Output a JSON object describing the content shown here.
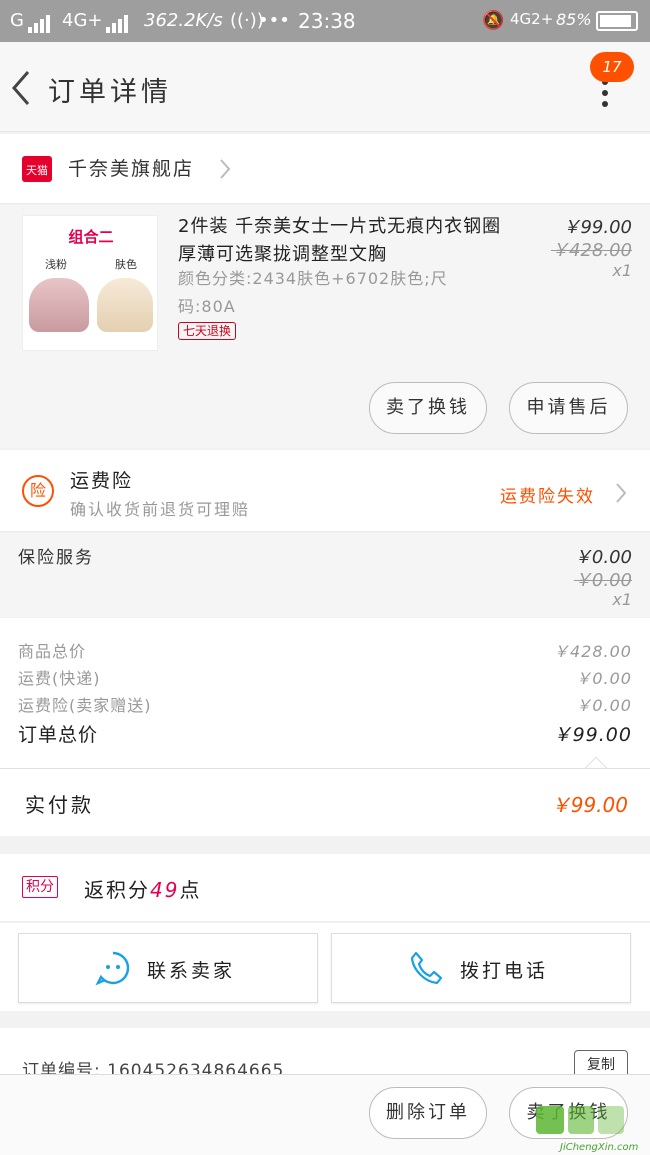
{
  "status_bar": {
    "carrier1": "G",
    "carrier2": "4G+",
    "speed": "362.2K/s",
    "dots": "•••",
    "time": "23:38",
    "net": "4G2+",
    "battery": "85%"
  },
  "header": {
    "title": "订单详情",
    "badge": "17"
  },
  "store": {
    "logo_text": "天猫",
    "name": "千奈美旗舰店"
  },
  "product": {
    "image_label": "组合二",
    "image_sub1": "浅粉",
    "image_sub2": "肤色",
    "title": "2件装 千奈美女士一片式无痕内衣钢圈厚薄可选聚拢调整型文胸",
    "sku": "颜色分类:2434肤色+6702肤色;尺码:80A",
    "tag": "七天退换",
    "price": "￥99.00",
    "original_price": "￥428.00",
    "qty": "x1",
    "btn_exchange": "卖了换钱",
    "btn_aftersale": "申请售后"
  },
  "insurance": {
    "icon_text": "险",
    "title": "运费险",
    "subtitle": "确认收货前退货可理赔",
    "status": "运费险失效"
  },
  "service": {
    "label": "保险服务",
    "price": "￥0.00",
    "original_price": "￥0.00",
    "qty": "x1"
  },
  "summary": {
    "rows": [
      {
        "label": "商品总价",
        "value": "￥428.00"
      },
      {
        "label": "运费(快递)",
        "value": "￥0.00"
      },
      {
        "label": "运费险(卖家赠送)",
        "value": "￥0.00"
      },
      {
        "label": "订单总价",
        "value": "￥99.00"
      }
    ]
  },
  "paid": {
    "label": "实付款",
    "value": "￥99.00"
  },
  "points": {
    "tag": "积分",
    "text_prefix": "返积分",
    "value": "49",
    "text_suffix": "点"
  },
  "contacts": {
    "seller": "联系卖家",
    "phone": "拨打电话"
  },
  "order": {
    "number": "订单编号: 160452634864665",
    "copy": "复制"
  },
  "bottom": {
    "delete": "删除订单",
    "exchange": "卖了换钱"
  },
  "watermark": {
    "text": "JiChengXin.com"
  },
  "colors": {
    "accent": "#ff5000",
    "tmall": "#e5002d",
    "points": "#e5004f",
    "icon_blue": "#1aa1e5"
  }
}
